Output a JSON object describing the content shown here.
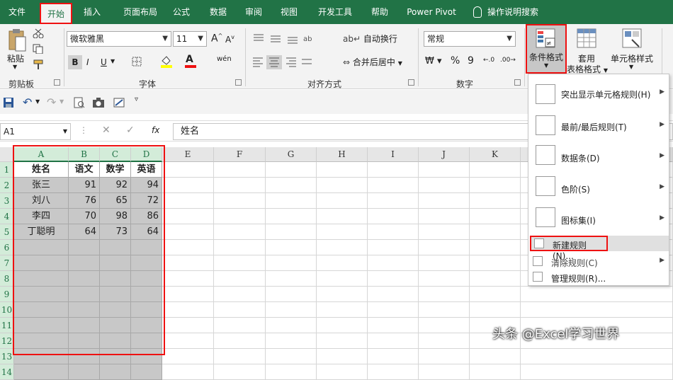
{
  "tabs": [
    {
      "label": "文件"
    },
    {
      "label": "开始"
    },
    {
      "label": "插入"
    },
    {
      "label": "页面布局"
    },
    {
      "label": "公式"
    },
    {
      "label": "数据"
    },
    {
      "label": "审阅"
    },
    {
      "label": "视图"
    },
    {
      "label": "开发工具"
    },
    {
      "label": "帮助"
    },
    {
      "label": "Power Pivot"
    }
  ],
  "tell_me": "操作说明搜索",
  "ribbon": {
    "clipboard": {
      "paste": "粘贴",
      "label": "剪贴板"
    },
    "font": {
      "name": "微软雅黑",
      "size": "11",
      "bold": "B",
      "italic": "I",
      "underline": "U",
      "label": "字体",
      "font_color": "A",
      "phonetic": "wén"
    },
    "alignment": {
      "wrap": "自动换行",
      "merge": "合并后居中",
      "label": "对齐方式"
    },
    "number": {
      "format": "常规",
      "percent": "%",
      "comma": "9",
      "label": "数字"
    },
    "styles": {
      "conditional": "条件格式",
      "table_line1": "套用",
      "table_line2": "表格格式",
      "cell_styles": "单元格样式"
    }
  },
  "formula_bar": {
    "name_box": "A1",
    "fx": "fx",
    "content": "姓名"
  },
  "columns": [
    "A",
    "B",
    "C",
    "D",
    "E",
    "F",
    "G",
    "H",
    "I",
    "J",
    "K"
  ],
  "rows": [
    "1",
    "2",
    "3",
    "4",
    "5",
    "6",
    "7",
    "8",
    "9",
    "10",
    "11",
    "12",
    "13",
    "14"
  ],
  "table": {
    "headers": [
      "姓名",
      "语文",
      "数学",
      "英语"
    ],
    "data": [
      [
        "张三",
        "91",
        "92",
        "94"
      ],
      [
        "刘八",
        "76",
        "65",
        "72"
      ],
      [
        "李四",
        "70",
        "98",
        "86"
      ],
      [
        "丁聪明",
        "64",
        "73",
        "64"
      ]
    ]
  },
  "menu": {
    "items": [
      {
        "label": "突出显示单元格规则(H)"
      },
      {
        "label": "最前/最后规则(T)"
      },
      {
        "label": "数据条(D)"
      },
      {
        "label": "色阶(S)"
      },
      {
        "label": "图标集(I)"
      },
      {
        "label": "新建规则(N)..."
      },
      {
        "label": "清除规则(C)"
      },
      {
        "label": "管理规则(R)..."
      }
    ]
  },
  "watermark": "头条 @Excel学习世界",
  "colors": {
    "accent": "#217346",
    "highlight": "#e11111",
    "selection": "#c8c8c8"
  }
}
